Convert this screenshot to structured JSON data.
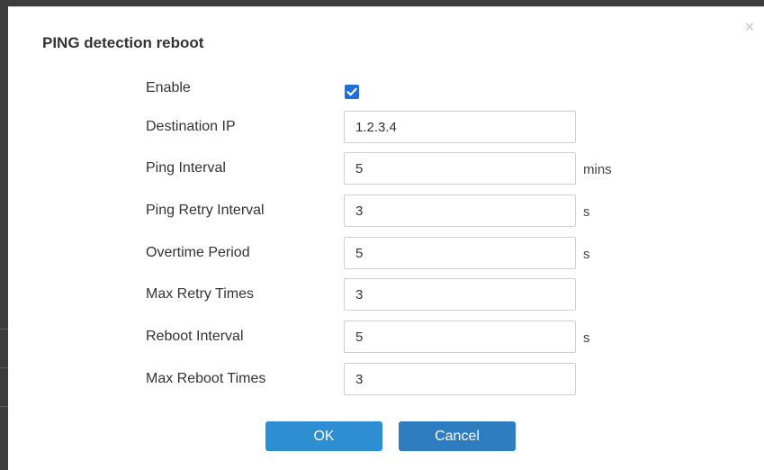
{
  "dialog": {
    "title": "PING detection reboot",
    "close_icon": "×",
    "enable": {
      "label": "Enable",
      "checked": true
    },
    "fields": [
      {
        "label": "Destination IP",
        "value": "1.2.3.4",
        "unit": ""
      },
      {
        "label": "Ping Interval",
        "value": "5",
        "unit": "mins"
      },
      {
        "label": "Ping Retry Interval",
        "value": "3",
        "unit": "s"
      },
      {
        "label": "Overtime Period",
        "value": "5",
        "unit": "s"
      },
      {
        "label": "Max Retry Times",
        "value": "3",
        "unit": ""
      },
      {
        "label": "Reboot Interval",
        "value": "5",
        "unit": "s"
      },
      {
        "label": "Max Reboot Times",
        "value": "3",
        "unit": ""
      }
    ],
    "buttons": {
      "ok": "OK",
      "cancel": "Cancel"
    }
  },
  "colors": {
    "primary_button": "#2d8fd1",
    "checkbox": "#1e6fd9",
    "backdrop": "#3c3c3c"
  }
}
